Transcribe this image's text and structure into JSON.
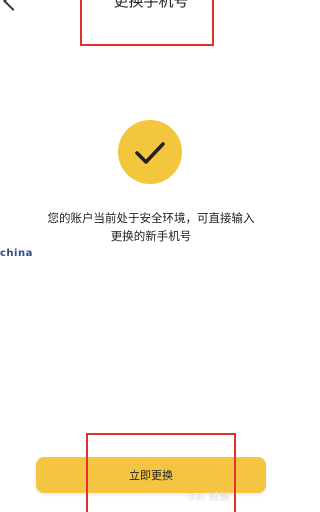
{
  "header": {
    "title": "更换手机号"
  },
  "status": {
    "message_line1": "您的账户当前处于安全环境，可直接输入",
    "message_line2": "更换的新手机号"
  },
  "actions": {
    "change_button_label": "立即更换"
  },
  "watermarks": {
    "left_text": "china",
    "right_text": "Bai 经验"
  },
  "colors": {
    "accent": "#f5c542",
    "check_circle": "#f4c63d",
    "annotation_border": "#e03030"
  }
}
